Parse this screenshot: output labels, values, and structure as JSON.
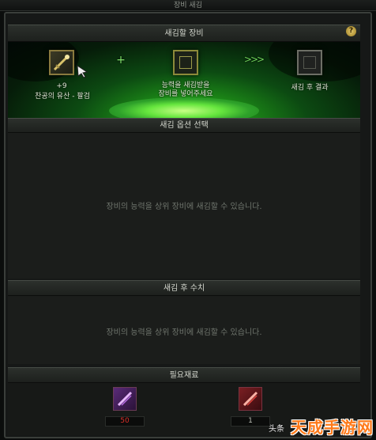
{
  "window": {
    "title": "장비 새김"
  },
  "help_icon": {
    "label": "?"
  },
  "engrave_equipment": {
    "header": "새김할 장비",
    "source_item": {
      "enhance": "+9",
      "name": "찬공의 유산 - 팔검"
    },
    "plus_icon": "+",
    "target_slot": {
      "label_line1": "능력을 새김받을",
      "label_line2": "장비를 넣어주세요"
    },
    "arrows_icon": ">>>",
    "result_slot": {
      "label": "새김 후 결과"
    }
  },
  "engrave_options": {
    "header": "새김 옵션 선택",
    "message": "장비의 능력을 상위 장비에 새김할 수 있습니다."
  },
  "after_engrave_stats": {
    "header": "새김 후 수치",
    "message": "장비의 능력을 상위 장비에 새김할 수 있습니다."
  },
  "required_materials": {
    "header": "필요재료",
    "items": [
      {
        "icon": "purple-sword-crystal-icon",
        "count": "50",
        "count_color": "#d9302a"
      },
      {
        "icon": "red-sword-crystal-icon",
        "count": "1",
        "count_color": "#b9bdb4"
      }
    ]
  },
  "watermark": {
    "small": "头条",
    "big": "天成手游网"
  }
}
